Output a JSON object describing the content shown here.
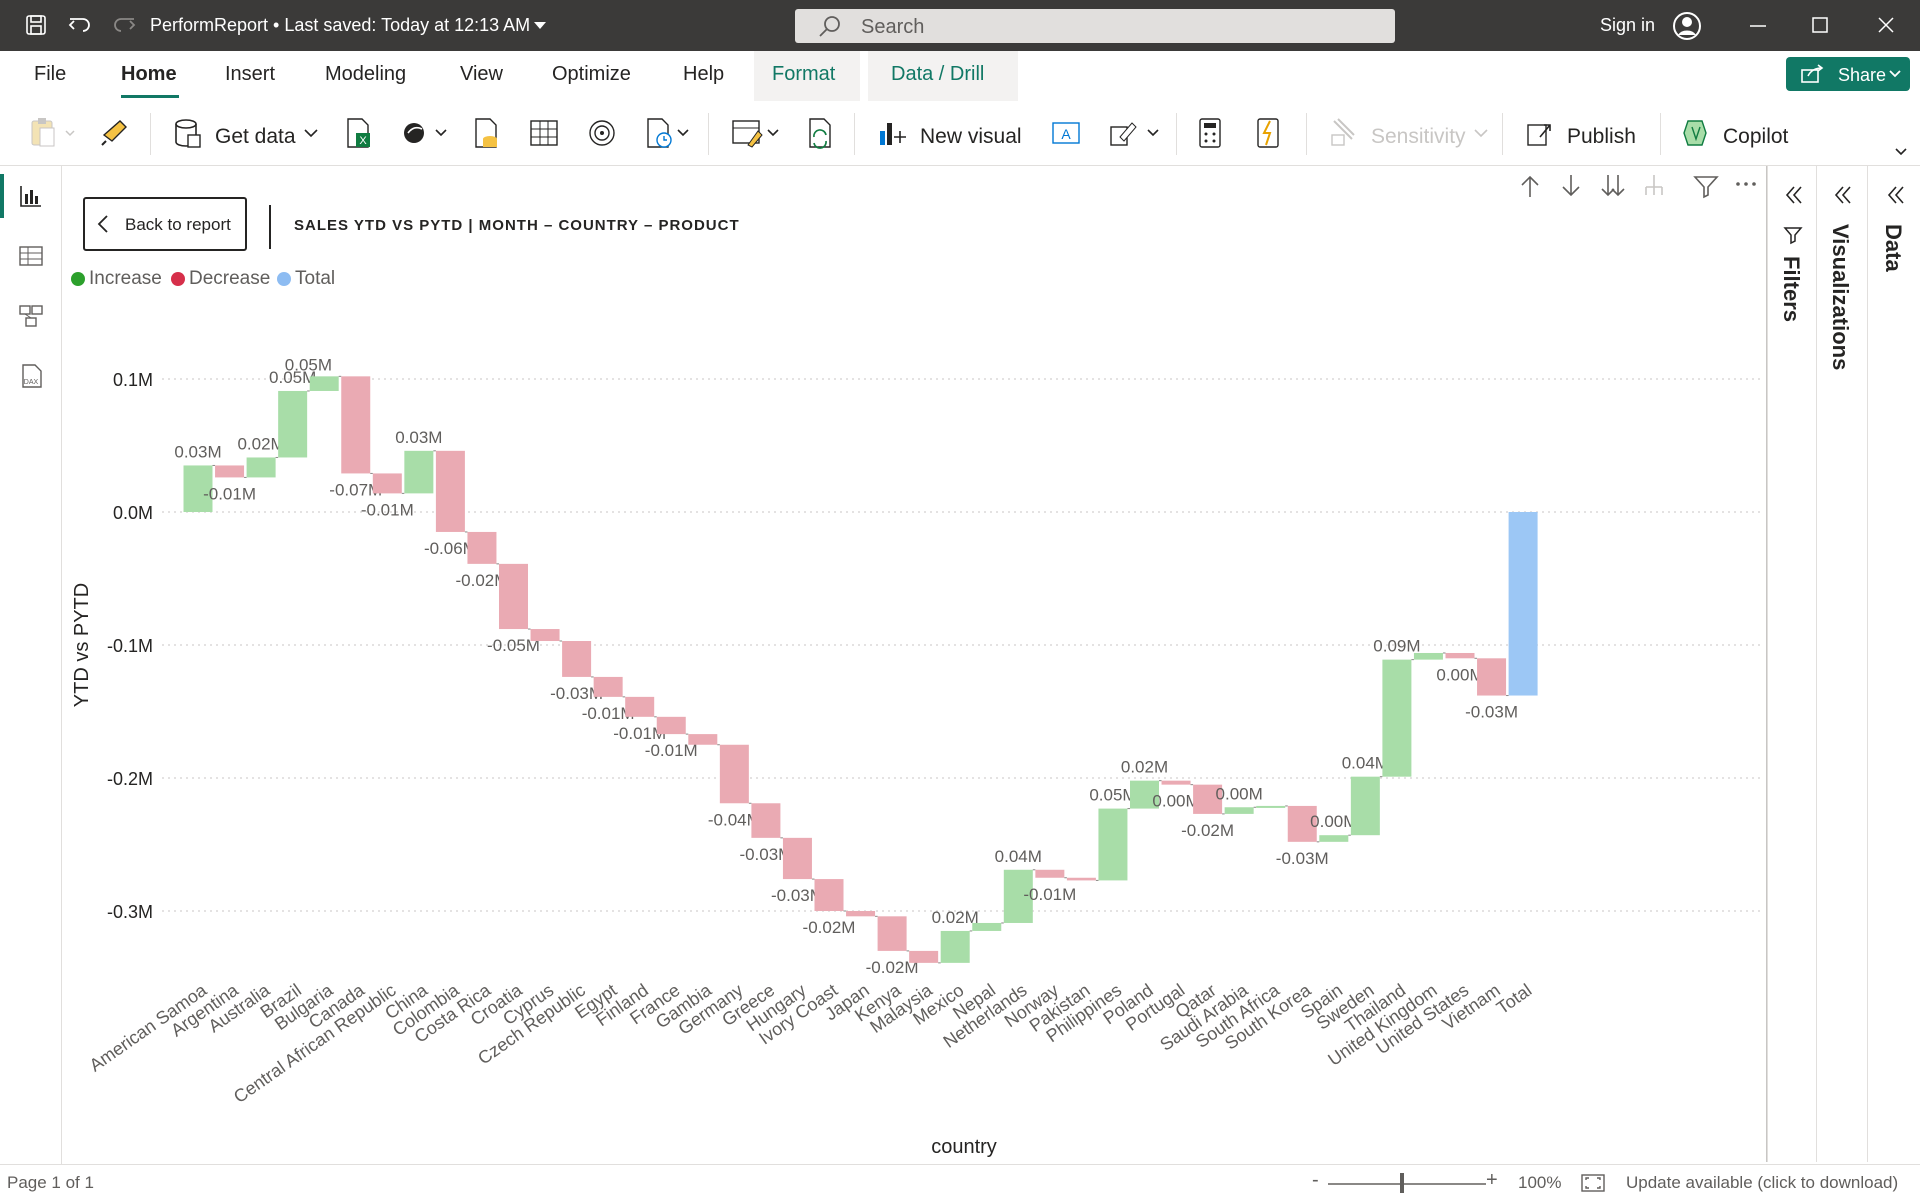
{
  "titlebar": {
    "title": "PerformReport • Last saved: Today at 12:13 AM",
    "search_placeholder": "Search",
    "sign_in": "Sign in"
  },
  "ribbon": {
    "tabs": [
      {
        "label": "File"
      },
      {
        "label": "Home"
      },
      {
        "label": "Insert"
      },
      {
        "label": "Modeling"
      },
      {
        "label": "View"
      },
      {
        "label": "Optimize"
      },
      {
        "label": "Help"
      },
      {
        "label": "Format"
      },
      {
        "label": "Data / Drill"
      }
    ],
    "active_tab": "Home",
    "share_label": "Share"
  },
  "toolbar": {
    "get_data": "Get data",
    "new_visual": "New visual",
    "sensitivity": "Sensitivity",
    "publish": "Publish",
    "copilot": "Copilot"
  },
  "report": {
    "back_label": "Back to report",
    "title": "SALES YTD VS PYTD | MONTH – COUNTRY – PRODUCT"
  },
  "colors": {
    "increase": "#a8dda8",
    "decrease": "#eaaab3",
    "total": "#9cc7f5",
    "increase_dot": "#2ca02c",
    "decrease_dot": "#d62f4a",
    "total_dot": "#8dbcf2",
    "accent": "#117865"
  },
  "chart_data": {
    "type": "waterfall",
    "xlabel": "country",
    "ylabel": "YTD vs PYTD",
    "ylim": [
      -0.37,
      0.12
    ],
    "yticks": [
      {
        "value": 0.1,
        "label": "0.1M"
      },
      {
        "value": 0.0,
        "label": "0.0M"
      },
      {
        "value": -0.1,
        "label": "-0.1M"
      },
      {
        "value": -0.2,
        "label": "-0.2M"
      },
      {
        "value": -0.3,
        "label": "-0.3M"
      }
    ],
    "legend": [
      {
        "name": "Increase",
        "color": "#2ca02c"
      },
      {
        "name": "Decrease",
        "color": "#d62f4a"
      },
      {
        "name": "Total",
        "color": "#8dbcf2"
      }
    ],
    "grid": true,
    "categories": [
      "American Samoa",
      "Argentina",
      "Australia",
      "Brazil",
      "Bulgaria",
      "Canada",
      "Central African Republic",
      "China",
      "Colombia",
      "Costa Rica",
      "Croatia",
      "Cyprus",
      "Czech Republic",
      "Egypt",
      "Finland",
      "France",
      "Gambia",
      "Germany",
      "Greece",
      "Hungary",
      "Ivory Coast",
      "Japan",
      "Kenya",
      "Malaysia",
      "Mexico",
      "Nepal",
      "Netherlands",
      "Norway",
      "Pakistan",
      "Philippines",
      "Poland",
      "Portugal",
      "Qatar",
      "Saudi Arabia",
      "South Africa",
      "South Korea",
      "Spain",
      "Sweden",
      "Thailand",
      "United Kingdom",
      "United States",
      "Vietnam",
      "Total"
    ],
    "values": [
      0.035,
      -0.009,
      0.015,
      0.05,
      0.011,
      -0.073,
      -0.015,
      0.032,
      -0.061,
      -0.024,
      -0.049,
      -0.009,
      -0.027,
      -0.015,
      -0.015,
      -0.013,
      -0.008,
      -0.044,
      -0.026,
      -0.031,
      -0.024,
      -0.004,
      -0.026,
      -0.009,
      0.024,
      0.006,
      0.04,
      -0.006,
      -0.002,
      0.054,
      0.021,
      -0.003,
      -0.022,
      0.005,
      0.001,
      -0.027,
      0.005,
      0.044,
      0.088,
      0.005,
      -0.004,
      -0.028,
      -0.136
    ],
    "data_labels": [
      "0.03M",
      "-0.01M",
      "0.02M",
      "0.05M",
      "",
      "-0.07M",
      "-0.01M",
      "0.03M",
      "-0.06M",
      "-0.02M",
      "-0.05M",
      "",
      "-0.03M",
      "-0.01M",
      "-0.01M",
      "-0.01M",
      "",
      "-0.04M",
      "-0.03M",
      "-0.03M",
      "-0.02M",
      "",
      "-0.02M",
      "",
      "0.02M",
      "",
      "0.04M",
      "-0.01M",
      "",
      "0.05M",
      "0.02M",
      "0.00M",
      "-0.02M",
      "0.00M",
      "",
      "-0.03M",
      "0.00M",
      "0.04M",
      "0.09M",
      "",
      "0.00M",
      "-0.03M",
      ""
    ],
    "bulgaria_label": "0.05M"
  },
  "statusbar": {
    "page": "Page 1 of 1",
    "zoom_minus": "-",
    "zoom_plus": "+",
    "zoom": "100%",
    "update": "Update available (click to download)"
  },
  "panes": {
    "filters": "Filters",
    "visualizations": "Visualizations",
    "data": "Data"
  }
}
